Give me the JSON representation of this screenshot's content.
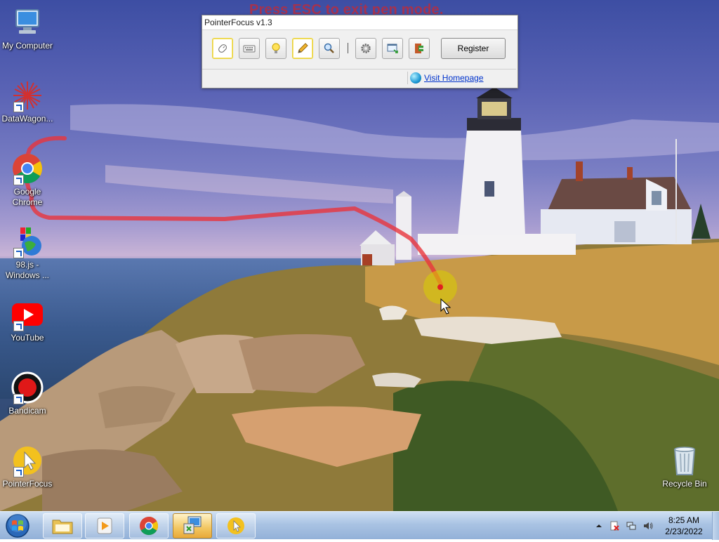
{
  "overlay": {
    "pen_message": "Press ESC to exit pen mode."
  },
  "desktop_icons": [
    {
      "label": "My Computer",
      "icon": "computer-icon"
    },
    {
      "label": "DataWagon...",
      "icon": "datawagon-icon"
    },
    {
      "label": "Google Chrome",
      "icon": "chrome-icon"
    },
    {
      "label": "98.js - Windows ...",
      "icon": "windows98-icon"
    },
    {
      "label": "YouTube",
      "icon": "youtube-icon"
    },
    {
      "label": "Bandicam",
      "icon": "bandicam-icon"
    },
    {
      "label": "PointerFocus",
      "icon": "pointerfocus-icon"
    },
    {
      "label": "Recycle Bin",
      "icon": "recycle-bin-icon"
    }
  ],
  "pointerfocus": {
    "title": "PointerFocus v1.3",
    "tools": [
      {
        "name": "cursor-highlight",
        "icon": "mouse-icon",
        "active": true
      },
      {
        "name": "keystroke",
        "icon": "keyboard-icon",
        "active": false
      },
      {
        "name": "spotlight",
        "icon": "bulb-icon",
        "active": false
      },
      {
        "name": "pen",
        "icon": "pencil-icon",
        "active": true
      },
      {
        "name": "magnifier",
        "icon": "magnifier-icon",
        "active": false
      },
      {
        "name": "settings",
        "icon": "gear-icon",
        "active": false
      },
      {
        "name": "screen",
        "icon": "screen-icon",
        "active": false
      },
      {
        "name": "exit",
        "icon": "exit-icon",
        "active": false
      }
    ],
    "separator": "|",
    "register_label": "Register",
    "homepage_label": "Visit Homepage"
  },
  "taskbar": {
    "start_icon": "windows-orb-icon",
    "apps": [
      {
        "name": "explorer",
        "icon": "folder-icon",
        "active": false
      },
      {
        "name": "media-player",
        "icon": "media-player-icon",
        "active": false
      },
      {
        "name": "chrome",
        "icon": "chrome-icon",
        "active": false
      },
      {
        "name": "control-panel",
        "icon": "control-panel-icon",
        "active": true
      },
      {
        "name": "pointerfocus",
        "icon": "pointerfocus-icon",
        "active": false
      }
    ],
    "tray_icons": [
      "show-hidden-icon",
      "action-center-icon",
      "network-icon",
      "volume-icon"
    ],
    "time": "8:25 AM",
    "date": "2/23/2022"
  },
  "colors": {
    "pen_stroke": "#e8343c",
    "highlight_ring": "#d8d000",
    "taskbar": "#a9c3e3"
  }
}
